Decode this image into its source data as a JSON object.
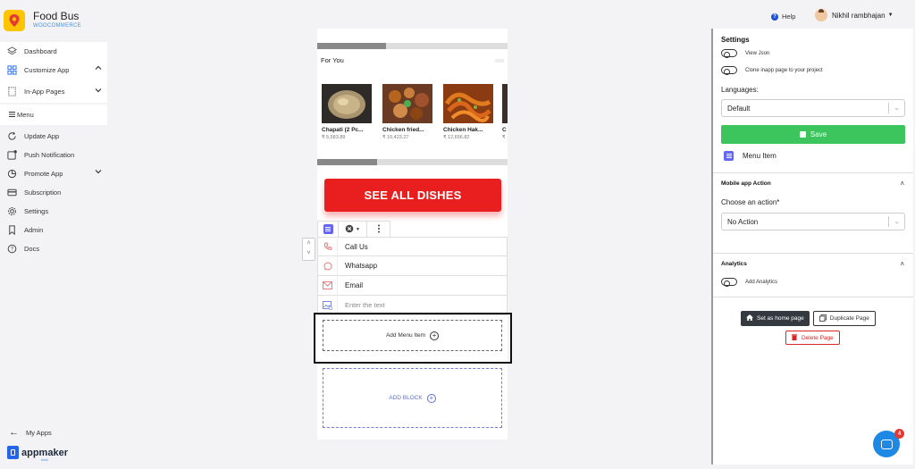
{
  "brand": {
    "name": "Food Bus",
    "subtitle": "WOOCOMMERCE"
  },
  "sidebar": {
    "items": [
      {
        "label": "Dashboard",
        "icon": "layers-icon"
      },
      {
        "label": "Customize App",
        "icon": "grid-icon",
        "chevron": "up"
      },
      {
        "label": "In-App Pages",
        "icon": "page-icon",
        "chevron": "down"
      },
      {
        "label": "Menu",
        "icon": "hamburger-icon"
      },
      {
        "label": "Update App",
        "icon": "refresh-icon"
      },
      {
        "label": "Push Notification",
        "icon": "notification-icon"
      },
      {
        "label": "Promote App",
        "icon": "pie-icon",
        "chevron": "down"
      },
      {
        "label": "Subscription",
        "icon": "card-icon"
      },
      {
        "label": "Settings",
        "icon": "gear-icon"
      },
      {
        "label": "Admin",
        "icon": "bookmark-icon"
      },
      {
        "label": "Docs",
        "icon": "help-circle-icon"
      }
    ],
    "my_apps": "My Apps",
    "footer_brand": "appmaker",
    "footer_sub": "beta"
  },
  "topbar": {
    "help": "Help",
    "user": "Nikhil rambhajan"
  },
  "canvas": {
    "section_title": "For You",
    "products": [
      {
        "name": "Chapati (2 Pc...",
        "price": "₹ 5,583.89"
      },
      {
        "name": "Chicken fried...",
        "price": "₹ 10,423.27"
      },
      {
        "name": "Chicken Hak...",
        "price": "₹ 12,656.82"
      },
      {
        "name": "C",
        "price": "₹"
      }
    ],
    "cta": "SEE ALL DISHES",
    "menu_items": [
      {
        "label": "Call Us",
        "icon": "phone-icon"
      },
      {
        "label": "Whatsapp",
        "icon": "whatsapp-icon"
      },
      {
        "label": "Email",
        "icon": "email-icon"
      }
    ],
    "new_item_placeholder": "Enter the text",
    "add_menu_item": "Add Menu Item",
    "add_block": "ADD BLOCK"
  },
  "panel": {
    "settings_title": "Settings",
    "toggles": [
      {
        "label": "View Json",
        "on": false
      },
      {
        "label": "Clone inapp page to your project",
        "on": false
      }
    ],
    "languages_label": "Languages:",
    "language_value": "Default",
    "save": "Save",
    "menu_item": "Menu Item",
    "mobile_action_title": "Mobile app Action",
    "choose_action_label": "Choose an action*",
    "action_value": "No Action",
    "analytics_title": "Analytics",
    "add_analytics": "Add Analytics",
    "set_home": "Set as home page",
    "duplicate": "Duplicate Page",
    "delete": "Delete Page"
  },
  "chat": {
    "badge": "4"
  },
  "colors": {
    "accent": "#6366f1",
    "save": "#3cc55d",
    "cta": "#e91f1f",
    "danger": "#dc2626",
    "brand": "#ffc400"
  }
}
